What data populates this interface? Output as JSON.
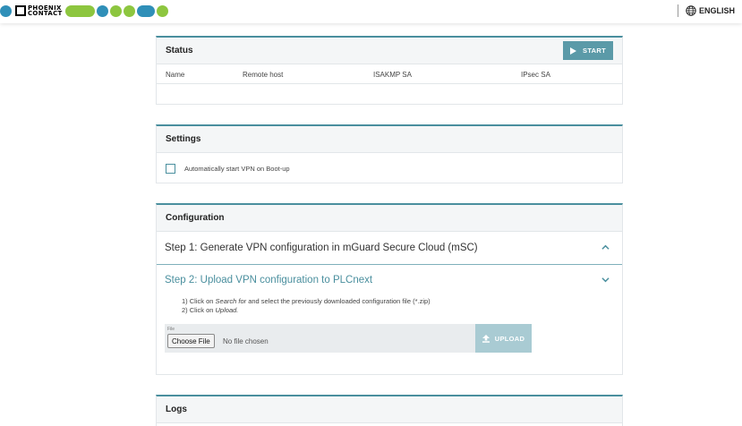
{
  "header": {
    "brand_line1": "PHOENIX",
    "brand_line2": "CONTACT",
    "language": "ENGLISH",
    "colors": {
      "blue": "#2f8fb8",
      "green": "#8dc63f"
    }
  },
  "status": {
    "title": "Status",
    "start_label": "START",
    "columns": [
      "Name",
      "Remote host",
      "ISAKMP SA",
      "IPsec SA"
    ]
  },
  "settings": {
    "title": "Settings",
    "autostart_label": "Automatically start VPN on Boot-up",
    "autostart_checked": false
  },
  "configuration": {
    "title": "Configuration",
    "step1_title": "Step 1: Generate VPN configuration in mGuard Secure Cloud (mSC)",
    "step2_title": "Step 2: Upload VPN configuration to PLCnext",
    "instr1_prefix": "1) Click on ",
    "instr1_em": "Search for",
    "instr1_suffix": " and select the previously downloaded configuration file (*.zip)",
    "instr2_prefix": "2) Click on ",
    "instr2_em": "Upload.",
    "file_label": "File",
    "choose_file_label": "Choose File",
    "no_file_text": "No file chosen",
    "upload_label": "UPLOAD"
  },
  "logs": {
    "title": "Logs"
  },
  "colors": {
    "accent": "#4a8f9e",
    "step2_text": "#4a8f9e",
    "button": "#5b9aa8",
    "upload_disabled": "#a9cbd3"
  }
}
